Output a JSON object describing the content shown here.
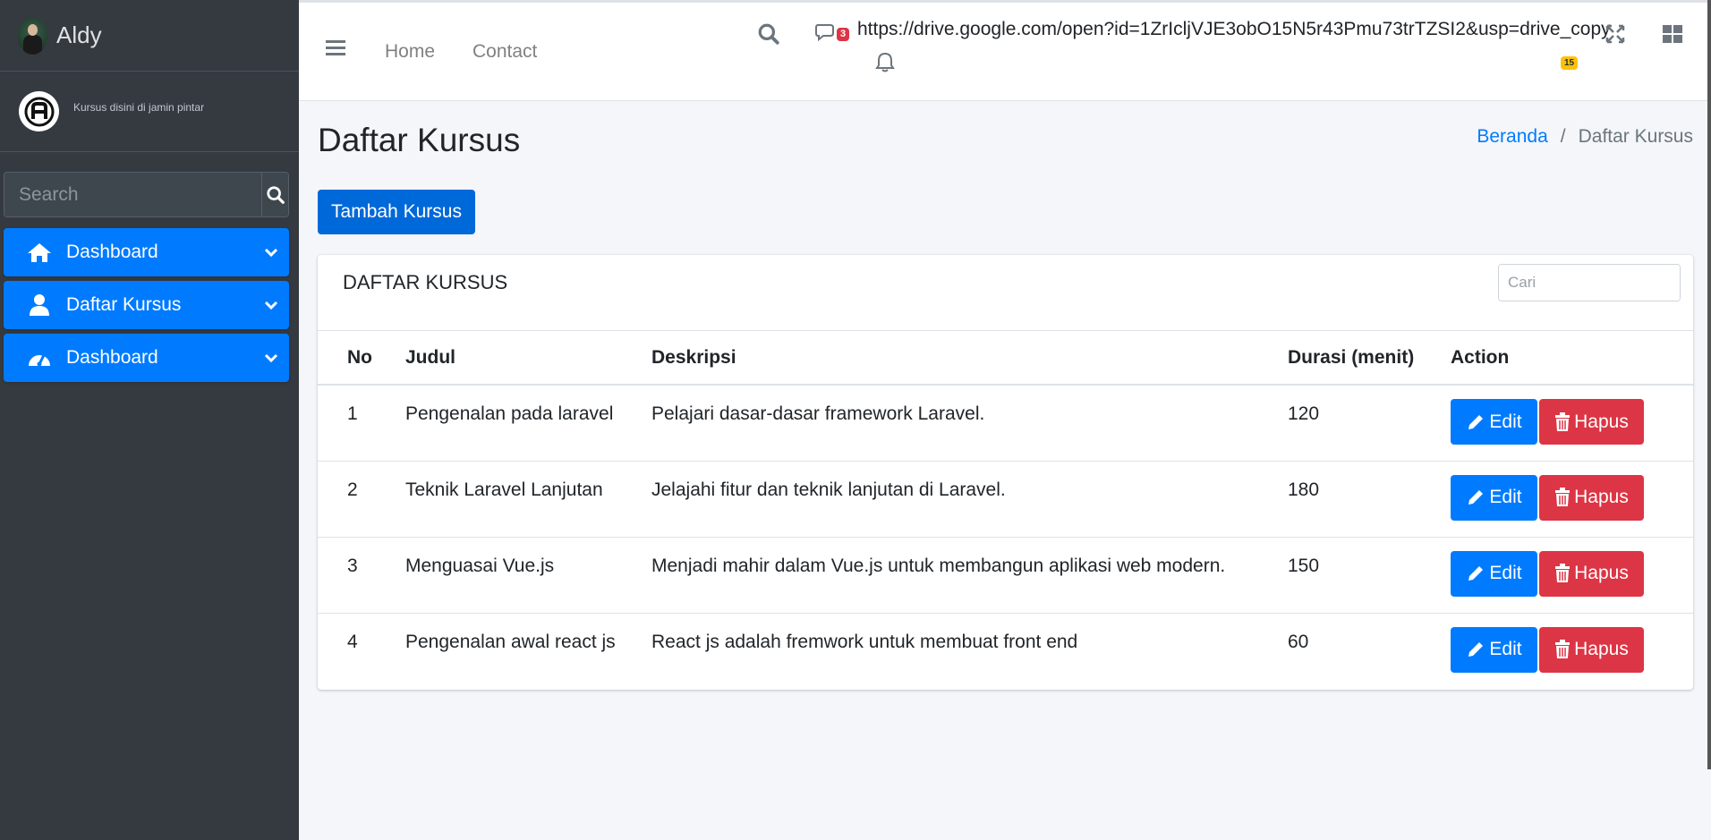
{
  "sidebar": {
    "brand": "Aldy",
    "tagline": "Kursus disini di jamin pintar",
    "search_placeholder": "Search",
    "items": [
      {
        "label": "Dashboard",
        "icon": "home-icon"
      },
      {
        "label": "Daftar Kursus",
        "icon": "user-icon"
      },
      {
        "label": "Dashboard",
        "icon": "tachometer-icon"
      }
    ]
  },
  "navbar": {
    "links": [
      "Home",
      "Contact"
    ],
    "messages_badge": "3",
    "url": "https://drive.google.com/open?id=1ZrIcljVJE3obO15N5r43Pmu73trTZSI2&usp=drive_copy",
    "notifications_badge": "15"
  },
  "page": {
    "title": "Daftar Kursus",
    "breadcrumb": [
      "Beranda",
      "/",
      "Daftar Kursus"
    ],
    "add_button": "Tambah Kursus"
  },
  "card": {
    "title": "DAFTAR KURSUS",
    "search_placeholder": "Cari",
    "columns": [
      "No",
      "Judul",
      "Deskripsi",
      "Durasi (menit)",
      "Action"
    ],
    "rows": [
      {
        "no": "1",
        "judul": "Pengenalan pada laravel",
        "deskripsi": "Pelajari dasar-dasar framework Laravel.",
        "durasi": "120"
      },
      {
        "no": "2",
        "judul": "Teknik Laravel Lanjutan",
        "deskripsi": "Jelajahi fitur dan teknik lanjutan di Laravel.",
        "durasi": "180"
      },
      {
        "no": "3",
        "judul": "Menguasai Vue.js",
        "deskripsi": "Menjadi mahir dalam Vue.js untuk membangun aplikasi web modern.",
        "durasi": "150"
      },
      {
        "no": "4",
        "judul": "Pengenalan awal react js",
        "deskripsi": "React js adalah fremwork untuk membuat front end",
        "durasi": "60"
      }
    ],
    "edit_label": "Edit",
    "delete_label": "Hapus"
  },
  "colors": {
    "primary": "#007bff",
    "danger": "#dc3545",
    "sidebar": "#343a40",
    "warning": "#ffc107"
  }
}
